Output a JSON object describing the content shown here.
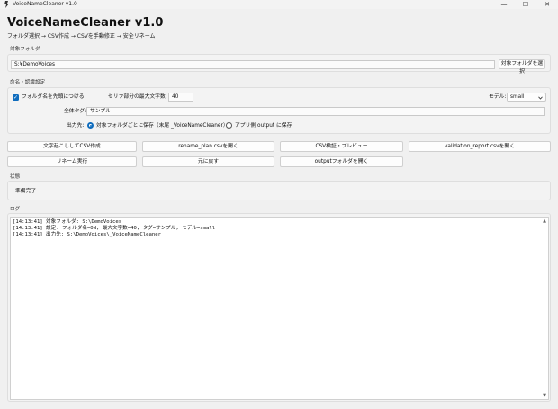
{
  "window": {
    "title": "VoiceNameCleaner v1.0",
    "minimize": "—",
    "maximize": "☐",
    "close": "✕"
  },
  "header": {
    "title": "VoiceNameCleaner v1.0",
    "subtitle": "フォルダ選択 → CSV作成 → CSVを手動修正 → 安全リネーム"
  },
  "target_folder": {
    "section_label": "対象フォルダ",
    "path": "S:¥DemoVoices",
    "select_button": "対象フォルダを選択"
  },
  "settings": {
    "section_label": "命名・認識設定",
    "prefix_folder_checkbox": "フォルダ名を先頭につける",
    "prefix_folder_checked": true,
    "max_chars_label": "セリフ部分の最大文字数:",
    "max_chars_value": "40",
    "model_label": "モデル:",
    "model_value": "small",
    "tag_label": "全体タグ:",
    "tag_value": "サンプル",
    "output_label": "出力先:",
    "output_option_folder": "対象フォルダごとに保存（末尾 _VoiceNameCleaner）",
    "output_option_app": "アプリ側 output に保存",
    "output_selected": "folder"
  },
  "actions": {
    "transcribe_csv": "文字起こししてCSV作成",
    "open_rename_plan": "rename_plan.csvを開く",
    "validate_csv": "CSV検証・プレビュー",
    "open_validation_report": "validation_report.csvを開く",
    "rename_execute": "リネーム実行",
    "restore": "元に戻す",
    "open_output_folder": "outputフォルダを開く"
  },
  "status": {
    "section_label": "状態",
    "text": "準備完了"
  },
  "log": {
    "section_label": "ログ",
    "lines": [
      "[14:13:41] 対象フォルダ: S:\\DemoVoices",
      "[14:13:41] 設定: フォルダ名=ON, 最大文字数=40, タグ=サンプル, モデル=small",
      "[14:13:41] 出力先: S:\\DemoVoices\\_VoiceNameCleaner"
    ],
    "scroll_up": "▲",
    "scroll_down": "▼"
  },
  "colors": {
    "accent": "#0f6cbd",
    "background": "#f0f0f0"
  }
}
